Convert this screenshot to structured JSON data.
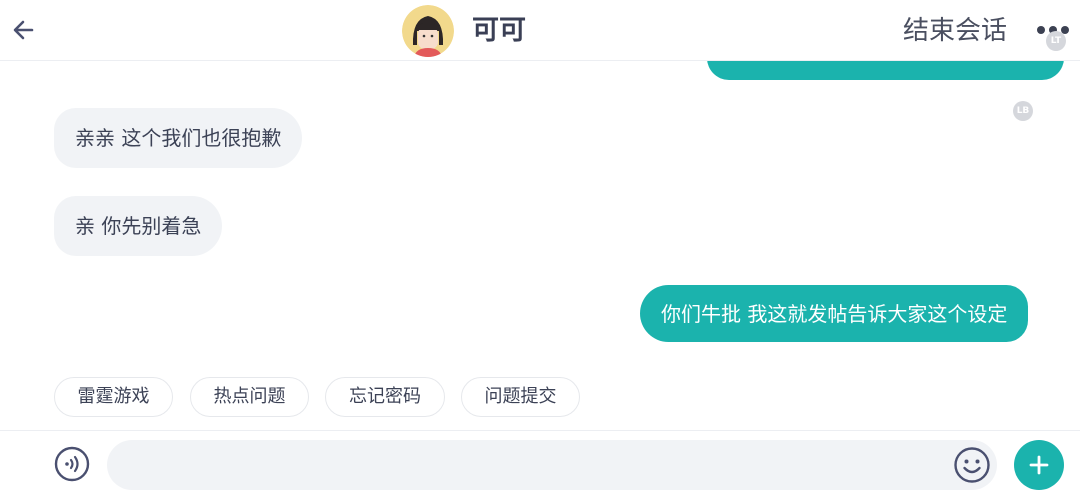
{
  "header": {
    "back_icon": "arrow-left-icon",
    "title": "可可",
    "end_label": "结束会话",
    "more_icon": "more-dots-icon",
    "badge_top": "LT",
    "badge_left": "LB"
  },
  "messages": [
    {
      "side": "out",
      "text": ""
    },
    {
      "side": "in",
      "text": "亲亲 这个我们也很抱歉"
    },
    {
      "side": "in",
      "text": "亲 你先别着急"
    },
    {
      "side": "out",
      "text": "你们牛批 我这就发帖告诉大家这个设定"
    }
  ],
  "quick_replies": [
    "雷霆游戏",
    "热点问题",
    "忘记密码",
    "问题提交"
  ],
  "input_bar": {
    "voice_icon": "voice-icon",
    "input_value": "",
    "input_placeholder": "",
    "emoji_icon": "emoji-icon",
    "plus_icon": "plus-icon"
  },
  "colors": {
    "accent": "#1bb3ad",
    "incoming_bubble": "#f1f3f6",
    "text_dark": "#3a3f55"
  }
}
